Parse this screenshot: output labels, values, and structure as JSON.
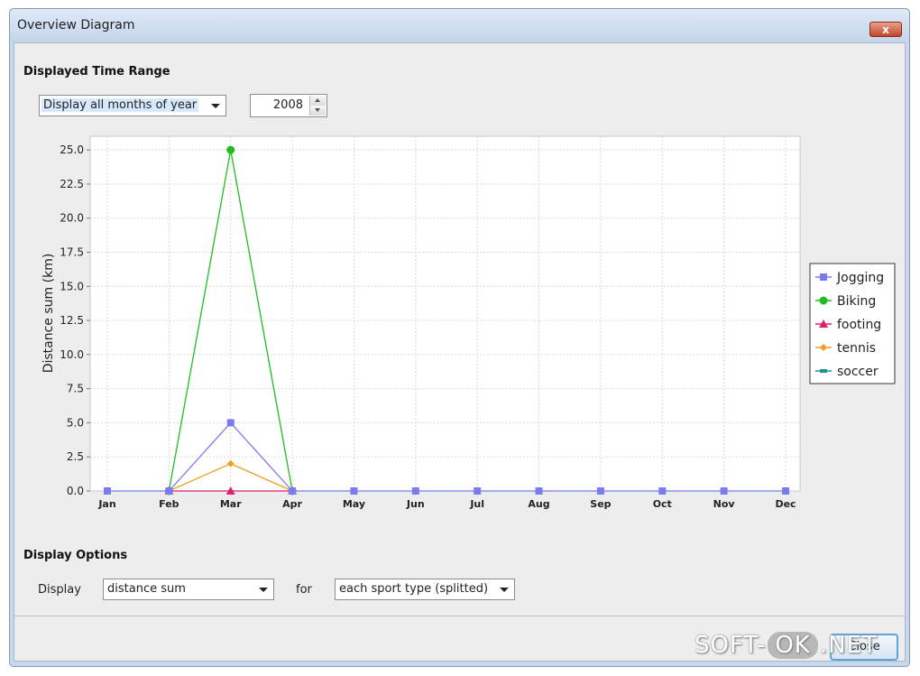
{
  "window": {
    "title": "Overview Diagram",
    "close_glyph": "x"
  },
  "time_range": {
    "section_label": "Displayed Time Range",
    "period_select": "Display all months of year",
    "year_value": "2008"
  },
  "display_options": {
    "section_label": "Display Options",
    "display_label": "Display",
    "measure_select": "distance sum",
    "for_label": "for",
    "grouping_select": "each sport type (splitted)"
  },
  "footer": {
    "close_label": "Close"
  },
  "watermark": {
    "left": "SOFT-",
    "pill": "OK",
    "right": ".NET"
  },
  "chart_data": {
    "type": "line",
    "categories": [
      "Jan",
      "Feb",
      "Mar",
      "Apr",
      "May",
      "Jun",
      "Jul",
      "Aug",
      "Sep",
      "Oct",
      "Nov",
      "Dec"
    ],
    "ylabel": "Distance sum (km)",
    "ylim": [
      0,
      26
    ],
    "yticks": [
      "0.0",
      "2.5",
      "5.0",
      "7.5",
      "10.0",
      "12.5",
      "15.0",
      "17.5",
      "20.0",
      "22.5",
      "25.0"
    ],
    "grid": true,
    "legend_position": "right",
    "series": [
      {
        "name": "Jogging",
        "color": "#7b7bf0",
        "marker": "square",
        "values": [
          0,
          0,
          5,
          0,
          0,
          0,
          0,
          0,
          0,
          0,
          0,
          0
        ]
      },
      {
        "name": "Biking",
        "color": "#22bb22",
        "marker": "circle",
        "values": [
          null,
          0,
          25,
          0,
          null,
          null,
          null,
          null,
          null,
          null,
          null,
          null
        ]
      },
      {
        "name": "footing",
        "color": "#e0206e",
        "marker": "triangle",
        "values": [
          null,
          0,
          0,
          0,
          null,
          null,
          null,
          null,
          null,
          null,
          null,
          null
        ]
      },
      {
        "name": "tennis",
        "color": "#f0a020",
        "marker": "diamond",
        "values": [
          null,
          0,
          2,
          0,
          null,
          null,
          null,
          null,
          null,
          null,
          null,
          null
        ]
      },
      {
        "name": "soccer",
        "color": "#209090",
        "marker": "dash",
        "values": [
          null,
          null,
          null,
          null,
          null,
          null,
          null,
          null,
          null,
          null,
          null,
          null
        ]
      }
    ]
  }
}
